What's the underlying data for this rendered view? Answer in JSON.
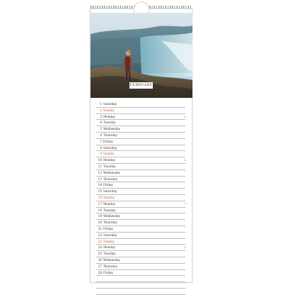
{
  "calendar": {
    "month": "FEBRUARY",
    "days": [
      {
        "n": "1",
        "wd": "Saturday"
      },
      {
        "n": "2",
        "wd": "Sunday",
        "sun": true
      },
      {
        "n": "3",
        "wd": "Monday",
        "mark": "5"
      },
      {
        "n": "4",
        "wd": "Tuesday"
      },
      {
        "n": "5",
        "wd": "Wednesday"
      },
      {
        "n": "6",
        "wd": "Thursday"
      },
      {
        "n": "7",
        "wd": "Friday"
      },
      {
        "n": "8",
        "wd": "Saturday"
      },
      {
        "n": "9",
        "wd": "Sunday",
        "sun": true
      },
      {
        "n": "10",
        "wd": "Monday",
        "mark": "6"
      },
      {
        "n": "11",
        "wd": "Tuesday"
      },
      {
        "n": "12",
        "wd": "Wednesday"
      },
      {
        "n": "13",
        "wd": "Thursday"
      },
      {
        "n": "14",
        "wd": "Friday"
      },
      {
        "n": "15",
        "wd": "Saturday"
      },
      {
        "n": "16",
        "wd": "Sunday",
        "sun": true
      },
      {
        "n": "17",
        "wd": "Monday",
        "mark": "7"
      },
      {
        "n": "18",
        "wd": "Tuesday"
      },
      {
        "n": "19",
        "wd": "Wednesday"
      },
      {
        "n": "20",
        "wd": "Thursday"
      },
      {
        "n": "21",
        "wd": "Friday"
      },
      {
        "n": "22",
        "wd": "Saturday"
      },
      {
        "n": "23",
        "wd": "Sunday",
        "sun": true
      },
      {
        "n": "24",
        "wd": "Monday",
        "mark": "8"
      },
      {
        "n": "25",
        "wd": "Tuesday"
      },
      {
        "n": "26",
        "wd": "Wednesday"
      },
      {
        "n": "27",
        "wd": "Thursday"
      },
      {
        "n": "28",
        "wd": "Friday"
      }
    ],
    "blank_rows": 3
  },
  "colors": {
    "sunday": "#c2562d",
    "text": "#333333",
    "rule": "#bdbdbd"
  }
}
